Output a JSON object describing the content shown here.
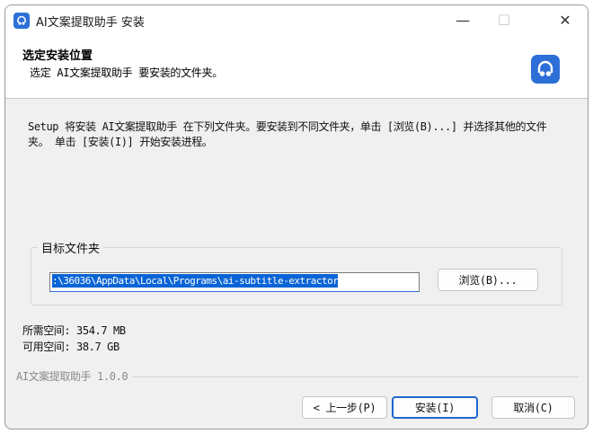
{
  "window": {
    "title": "AI文案提取助手 安装",
    "controls": {
      "minimize": "—",
      "maximize": "☐",
      "close": "✕"
    }
  },
  "header": {
    "title": "选定安装位置",
    "subtitle": "选定 AI文案提取助手 要安装的文件夹。",
    "icon": "app-icon",
    "accent": "#2c6fd6"
  },
  "description": "Setup 将安装 AI文案提取助手 在下列文件夹。要安装到不同文件夹，单击 [浏览(B)...] 并选择其他的文件夹。 单击 [安装(I)] 开始安装进程。",
  "destination": {
    "group_label": "目标文件夹",
    "path": ":\\36036\\AppData\\Local\\Programs\\ai-subtitle-extractor",
    "browse_label": "浏览(B)..."
  },
  "space": {
    "required": "所需空间: 354.7 MB",
    "available": "可用空间: 38.7 GB"
  },
  "brand": "AI文案提取助手 1.0.0",
  "buttons": {
    "back": "< 上一步(P)",
    "install": "安装(I)",
    "cancel": "取消(C)"
  }
}
